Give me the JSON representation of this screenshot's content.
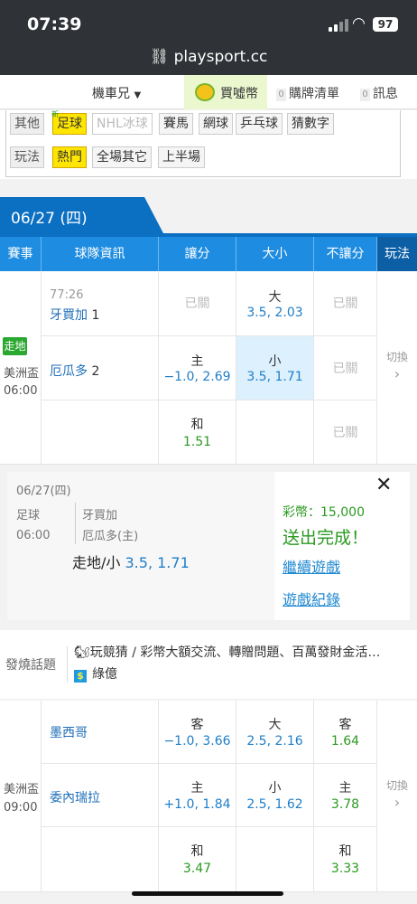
{
  "status": {
    "time": "07:39",
    "battery": "97"
  },
  "browser": {
    "url": "playsport.cc"
  },
  "subnav": {
    "user": "機車兄",
    "buy": "買噓幣",
    "cart_count": "0",
    "cart": "購牌清單",
    "msg_count": "0",
    "msg": "訊息"
  },
  "filter": {
    "other_label": "其他",
    "sports": [
      "足球",
      "NHL冰球",
      "賽馬",
      "網球",
      "乒乓球",
      "猜數字"
    ],
    "new_tag": "新",
    "play_label": "玩法",
    "plays": [
      "熱門",
      "全場其它",
      "上半場"
    ]
  },
  "date_tab": "06/27 (四)",
  "table_header": [
    "賽事",
    "球隊資訊",
    "讓分",
    "大小",
    "不讓分",
    "玩法"
  ],
  "match1": {
    "status_tag": "走地",
    "league": "美洲盃",
    "time": "06:00",
    "clock": "77:26",
    "team_a": "牙買加",
    "score_a": "1",
    "team_b": "厄瓜多",
    "score_b": "2",
    "row1": {
      "spread": "已關",
      "ou_label": "大",
      "ou_value": "3.5, 2.03",
      "ml": "已關"
    },
    "row2": {
      "spread_label": "主",
      "spread_value": "−1.0, 2.69",
      "ou_label": "小",
      "ou_value": "3.5, 1.71",
      "ml": "已關"
    },
    "row3": {
      "spread_label": "和",
      "spread_value": "1.51",
      "ml": "已關"
    },
    "switch": "切換",
    "switch_arrow": "›"
  },
  "bet_card": {
    "date": "06/27(四)",
    "sport": "足球",
    "time": "06:00",
    "team_a": "牙買加",
    "team_b": "厄瓜多(主)",
    "pick_label": "走地/小",
    "pick_value": "3.5, 1.71",
    "coins": "彩幣：15,000",
    "done": "送出完成！",
    "continue": "繼續遊戲",
    "record": "遊戲紀錄",
    "close": "✕"
  },
  "hot_topic": {
    "label": "發燒話題",
    "msg": "🐿玩競猜 / 彩幣大額交流、轉贈問題、百萬發財金活…",
    "badge": "$",
    "user": "綠億"
  },
  "match2": {
    "league": "美洲盃",
    "time": "09:00",
    "team_a": "墨西哥",
    "team_b": "委內瑞拉",
    "row1": {
      "spread_label": "客",
      "spread_value": "−1.0, 3.66",
      "ou_label": "大",
      "ou_value": "2.5, 2.16",
      "ml_label": "客",
      "ml_value": "1.64"
    },
    "row2": {
      "spread_label": "主",
      "spread_value": "+1.0, 1.84",
      "ou_label": "小",
      "ou_value": "2.5, 1.62",
      "ml_label": "主",
      "ml_value": "3.78"
    },
    "row3": {
      "spread_label": "和",
      "spread_value": "3.47",
      "ml_label": "和",
      "ml_value": "3.33"
    },
    "switch": "切換",
    "switch_arrow": "›"
  }
}
